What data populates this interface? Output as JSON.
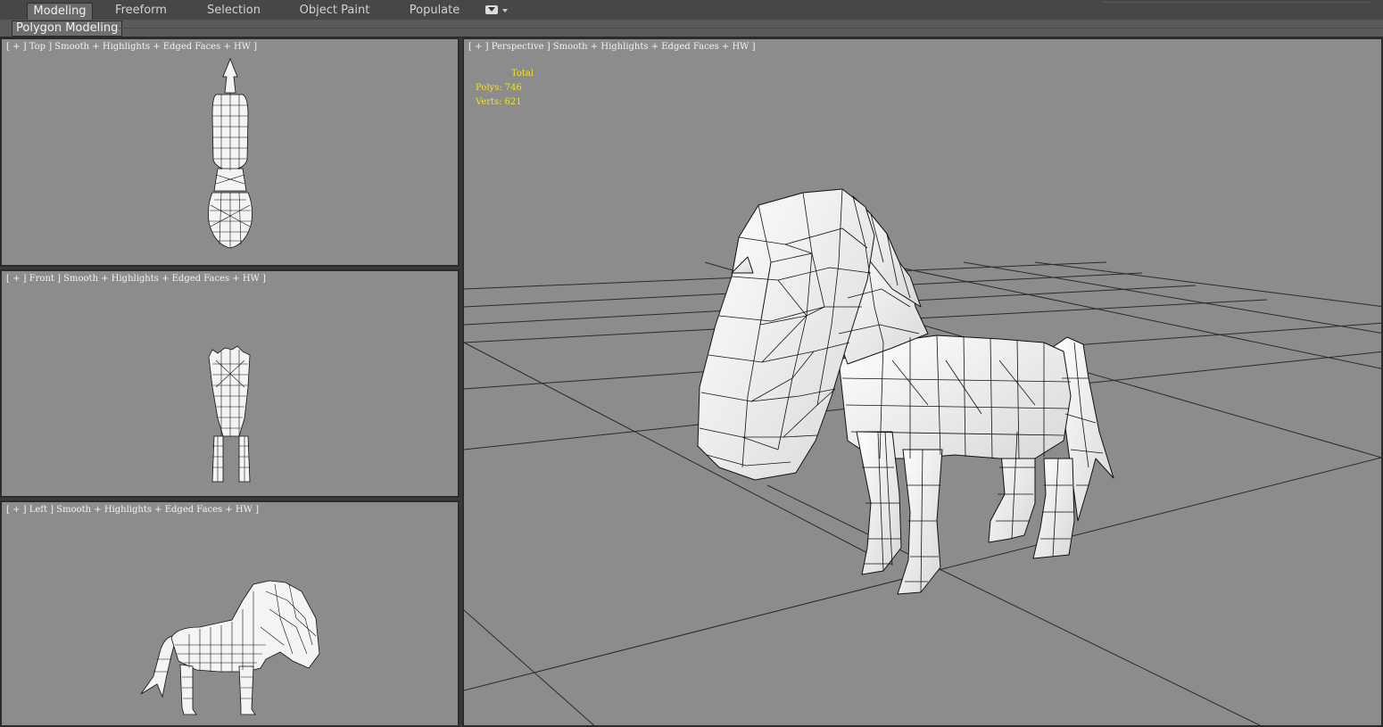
{
  "ribbon": {
    "tabs": [
      "Modeling",
      "Freeform",
      "Selection",
      "Object Paint",
      "Populate"
    ],
    "active_tab": "Modeling",
    "sub_tab": "Polygon Modeling"
  },
  "viewports": {
    "top": {
      "label": "[ + ] Top ] Smooth + Highlights + Edged Faces + HW ]"
    },
    "front": {
      "label": "[ + ] Front ] Smooth + Highlights + Edged Faces + HW ]"
    },
    "left": {
      "label": "[ + ] Left ] Smooth + Highlights + Edged Faces + HW ]"
    },
    "perspective": {
      "label": "[ + ] Perspective ] Smooth + Highlights + Edged Faces + HW ]",
      "stats": {
        "header": "Total",
        "polys_label": "Polys:",
        "polys_value": "746",
        "verts_label": "Verts:",
        "verts_value": "621"
      }
    }
  },
  "colors": {
    "viewport_bg": "#8c8c8c",
    "stats_text": "#f2e21c",
    "ui_bg": "#474747"
  },
  "icons": [
    "viewport-dropdown-icon",
    "horse-model"
  ]
}
